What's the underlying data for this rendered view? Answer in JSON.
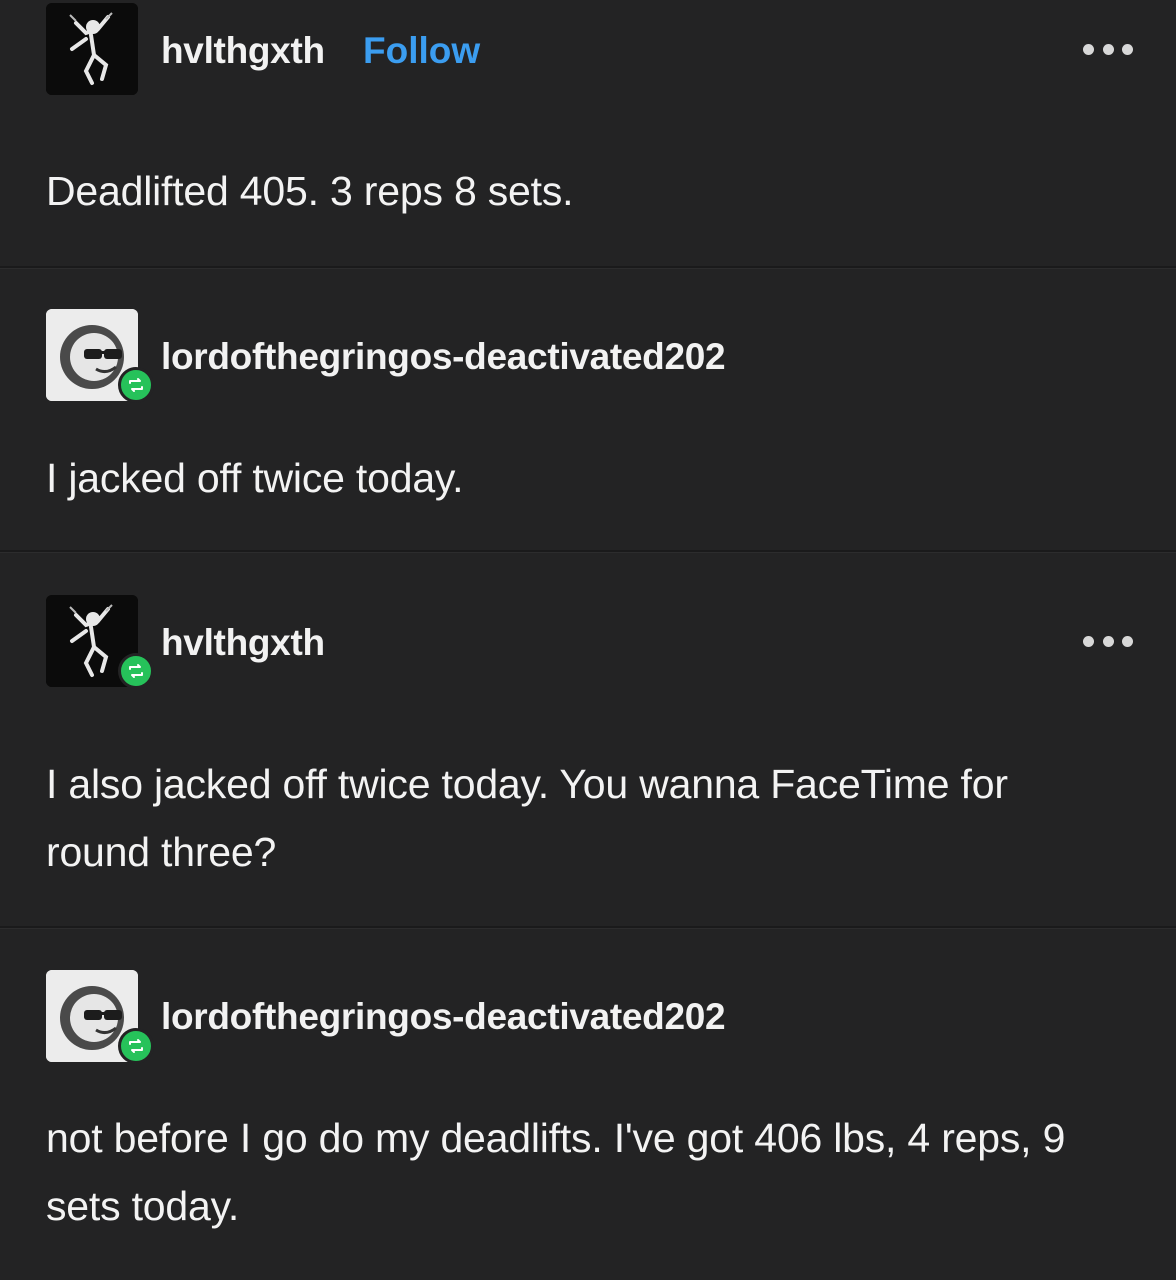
{
  "posts": [
    {
      "username": "hvlthgxth",
      "follow_label": "Follow",
      "has_more_menu": true,
      "reblog": false,
      "text": "Deadlifted 405. 3 reps 8 sets."
    },
    {
      "username": "lordofthegringos-deactivated202",
      "has_more_menu": false,
      "reblog": true,
      "text": "I jacked off twice today."
    },
    {
      "username": "hvlthgxth",
      "has_more_menu": true,
      "reblog": true,
      "text": "I also jacked off twice today. You wanna FaceTime for round three?"
    },
    {
      "username": "lordofthegringos-deactivated202",
      "has_more_menu": false,
      "reblog": true,
      "text": "not before I go do my deadlifts. I've got 406 lbs, 4 reps, 9 sets today."
    }
  ],
  "colors": {
    "background": "#232324",
    "follow": "#3b9df0",
    "reblog_badge": "#26c25a"
  },
  "icons": {
    "more": "more-options-icon",
    "reblog": "reblog-icon"
  }
}
